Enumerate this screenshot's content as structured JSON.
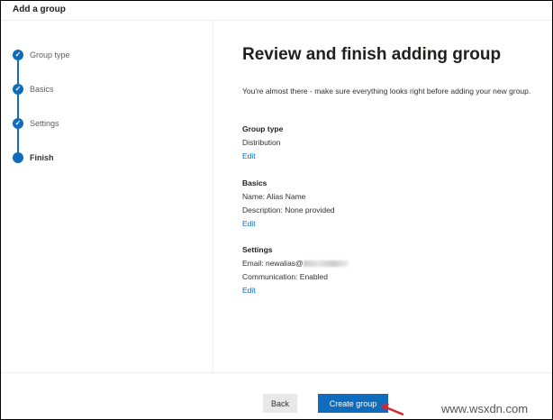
{
  "header": {
    "title": "Add a group"
  },
  "steps": [
    {
      "label": "Group type"
    },
    {
      "label": "Basics"
    },
    {
      "label": "Settings"
    },
    {
      "label": "Finish"
    }
  ],
  "main": {
    "title": "Review and finish adding group",
    "subtitle": "You're almost there - make sure everything looks right before adding your new group.",
    "group_type": {
      "heading": "Group type",
      "value": "Distribution",
      "edit": "Edit"
    },
    "basics": {
      "heading": "Basics",
      "name": "Name: Alias Name",
      "description": "Description: None provided",
      "edit": "Edit"
    },
    "settings": {
      "heading": "Settings",
      "email": "Email: newalias@",
      "communication": "Communication: Enabled",
      "edit": "Edit"
    }
  },
  "footer": {
    "back": "Back",
    "create": "Create group"
  },
  "watermark": "www.wsxdn.com"
}
